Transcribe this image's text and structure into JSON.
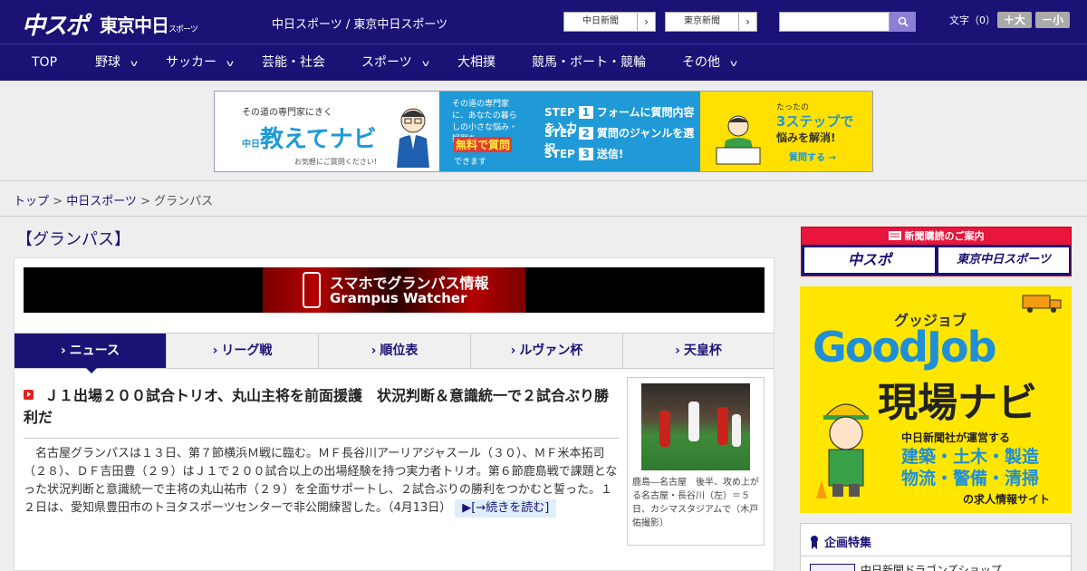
{
  "header": {
    "logo_chuspo": "中スポ",
    "logo_tokyo": "東京中日",
    "logo_tokyo_small": "スポーツ",
    "site_names": "中日スポーツ / 東京中日スポーツ",
    "btn_chunichi": "中日新聞",
    "btn_tokyo": "東京新聞",
    "arrow": "›",
    "search_placeholder": "",
    "font_label": "文字（0）",
    "font_larger": "＋大",
    "font_smaller": "－小"
  },
  "nav": {
    "items": [
      {
        "label": "TOP"
      },
      {
        "label": "野球"
      },
      {
        "label": "サッカー"
      },
      {
        "label": "芸能・社会"
      },
      {
        "label": "スポーツ"
      },
      {
        "label": "大相撲"
      },
      {
        "label": "競馬・ボート・競輪"
      },
      {
        "label": "その他"
      }
    ],
    "chevron": "v"
  },
  "ad_banner": {
    "left_small": "その道の専門家にきく",
    "left_brand_prefix": "中日",
    "left_brand": "教えてナビ",
    "left_note": "お気軽にご質問ください!",
    "mid_desc": "その道の専門家に、あなたの暮らしの小さな悩み・疑問を",
    "mid_free": "無料で質問",
    "mid_can": "できます",
    "steps": [
      {
        "prefix": "STEP",
        "num": "1",
        "text": "フォームに質問内容を入力"
      },
      {
        "prefix": "STEP",
        "num": "2",
        "text": "質問のジャンルを選択"
      },
      {
        "prefix": "STEP",
        "num": "3",
        "text": "送信!"
      }
    ],
    "right_small": "たったの",
    "right_steps": "3ステップで",
    "right_solve": "悩みを解消!",
    "right_cta": "質問する →"
  },
  "breadcrumb": {
    "home": "トップ",
    "sep": " > ",
    "section": "中日スポーツ",
    "current": "グランパス"
  },
  "page": {
    "title": "【グランパス】"
  },
  "grampus_banner": {
    "line1": "スマホでグランパス情報",
    "line2": "Grampus Watcher"
  },
  "tabs": [
    {
      "label": "ニュース",
      "active": true
    },
    {
      "label": "リーグ戦",
      "active": false
    },
    {
      "label": "順位表",
      "active": false
    },
    {
      "label": "ルヴァン杯",
      "active": false
    },
    {
      "label": "天皇杯",
      "active": false
    }
  ],
  "tab_glyph": "›",
  "article": {
    "headline": "Ｊ１出場２００試合トリオ、丸山主将を前面援護　状況判断＆意識統一で２試合ぶり勝利だ",
    "body": "　名古屋グランパスは１３日、第７節横浜Ｍ戦に臨む。ＭＦ長谷川アーリアジャスール（３０）、ＭＦ米本拓司（２８）、ＤＦ吉田豊（２９）はＪ１で２００試合以上の出場経験を持つ実力者トリオ。第６節鹿島戦で課題となった状況判断と意識統一で主将の丸山祐市（２９）を全面サポートし、２試合ぶりの勝利をつかむと誓った。１２日は、愛知県豊田市のトヨタスポーツセンターで非公開練習した。（4月13日）",
    "readmore": "▶[→続きを読む]",
    "photo_caption": "鹿島―名古屋　後半、攻め上がる名古屋・長谷川（左）＝５日、カシマスタジアムで（木戸佑撮影）"
  },
  "sidebar": {
    "subscribe_header": "新聞購読のご案内",
    "subscribe_chuspo": "中スポ",
    "subscribe_tokyo": "東京中日スポーツ",
    "job_top": "グッジョブ",
    "job_brand": "GoodJob",
    "job_title": "現場ナビ",
    "job_sub": "中日新聞社が運営する",
    "job_fields": "建築・土木・製造　物流・警備・清掃",
    "job_site": "の求人情報サイト",
    "plan_header": "企画特集",
    "plan_item": "中日新聞ドラゴンズショップ"
  },
  "colors": {
    "brand_navy": "#1a1275",
    "accent_blue": "#1f9ad6",
    "accent_yellow": "#ffe600",
    "accent_red": "#e8153c"
  }
}
